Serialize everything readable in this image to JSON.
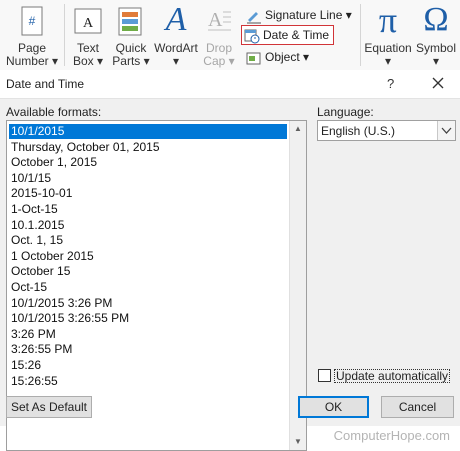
{
  "ribbon": {
    "page_number": {
      "line1": "Page",
      "line2": "Number"
    },
    "text_box": {
      "line1": "Text",
      "line2": "Box"
    },
    "quick_parts": {
      "line1": "Quick",
      "line2": "Parts"
    },
    "wordart": {
      "line1": "WordArt",
      "line2": ""
    },
    "drop_cap": {
      "line1": "Drop",
      "line2": "Cap"
    },
    "signature_line": "Signature Line",
    "date_time": "Date & Time",
    "object": "Object",
    "equation": "Equation",
    "symbol": "Symbol",
    "dropdown_glyph": "▾",
    "pi_glyph": "π",
    "omega_glyph": "Ω",
    "wordart_glyph": "A",
    "hash_glyph": "#"
  },
  "dialog": {
    "title": "Date and Time",
    "help": "?",
    "available_formats_label": "Available formats:",
    "formats": [
      "10/1/2015",
      "Thursday, October 01, 2015",
      "October 1, 2015",
      "10/1/15",
      "2015-10-01",
      "1-Oct-15",
      "10.1.2015",
      "Oct. 1, 15",
      "1 October 2015",
      "October 15",
      "Oct-15",
      "10/1/2015 3:26 PM",
      "10/1/2015 3:26:55 PM",
      "3:26 PM",
      "3:26:55 PM",
      "15:26",
      "15:26:55"
    ],
    "selected_index": 0,
    "language_label": "Language:",
    "language_value": "English (U.S.)",
    "update_automatically": "Update automatically",
    "update_checked": false,
    "set_as_default": "Set As Default",
    "ok": "OK",
    "cancel": "Cancel"
  },
  "watermark": "ComputerHope.com",
  "colors": {
    "selection": "#0078d7",
    "highlight_border": "#d13438",
    "accent_blue": "#1f5fa8"
  }
}
